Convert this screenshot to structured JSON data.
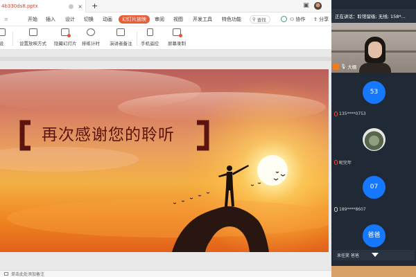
{
  "tabbar": {
    "doc_name": "4b330ds8.pptx",
    "close_glyph": "×",
    "new_tab_glyph": "+"
  },
  "menu": {
    "items": [
      "开始",
      "插入",
      "设计",
      "切换",
      "动画",
      "幻灯片放映",
      "审阅",
      "视图",
      "开发工具",
      "特色功能"
    ],
    "active_index": 5,
    "search_label": "查找",
    "collab_label": "协作",
    "share_label": "分享"
  },
  "toolbar": {
    "items": [
      "设置放映方式",
      "隐藏幻灯片",
      "排练计时",
      "演讲者备注",
      "手机遥控",
      "屏幕录制"
    ],
    "left_cut_label": "设"
  },
  "slide": {
    "title": "再次感谢您的聆听"
  },
  "status": {
    "note_placeholder": "单击此处添加备注"
  },
  "meeting": {
    "status_text": "正在讲话：聆馆留级; 无线; 158*...",
    "host_name": "大棚",
    "participants": [
      {
        "avatar": "53",
        "label": "135****0753",
        "muted": true
      },
      {
        "avatar": "",
        "label": "昵完年",
        "muted": true,
        "photo": true
      },
      {
        "avatar": "07",
        "label": "189****8607",
        "muted": false
      },
      {
        "avatar": "爸爸",
        "label": "",
        "muted": false
      }
    ],
    "bottom_label": "呆任笑  爸爸"
  },
  "colors": {
    "accent": "#e85c3a",
    "avatar_blue": "#1677ff",
    "panel_bg": "#1f2a36",
    "title_color": "#5b140f"
  }
}
